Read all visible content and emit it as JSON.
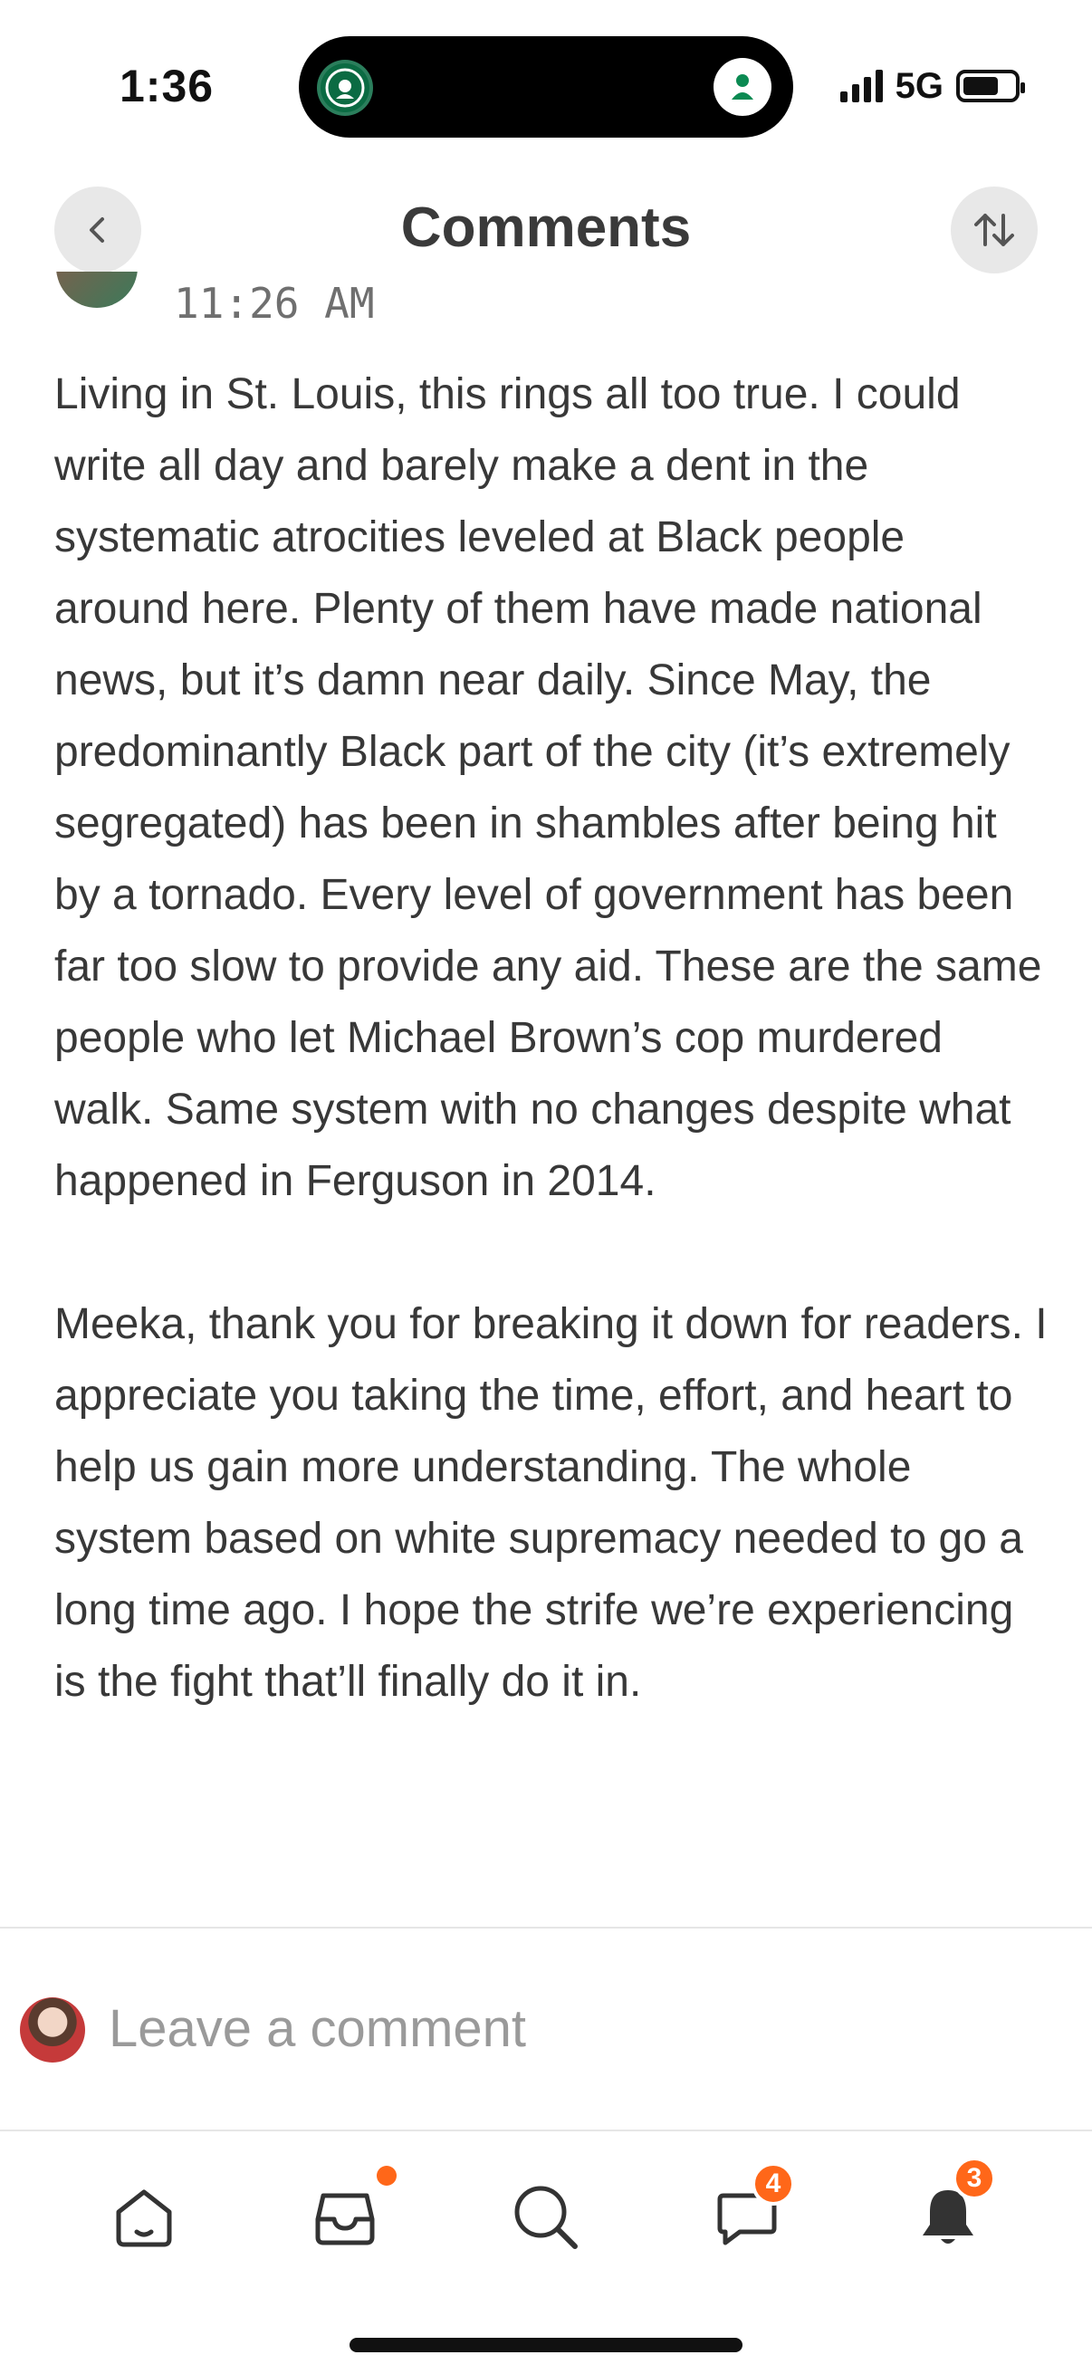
{
  "status_bar": {
    "time": "1:36",
    "network": "5G",
    "island_left_icon": "starbucks-logo-icon",
    "island_right_icon": "person-activity-icon"
  },
  "header": {
    "title": "Comments",
    "back_icon": "chevron-left-icon",
    "sort_icon": "sort-arrows-icon"
  },
  "comment": {
    "timestamp": "11:26 AM",
    "paragraphs": [
      "Living in St. Louis, this rings all too true. I could write all day and barely make a dent in the systematic atrocities leveled at Black people around here. Plenty of them have made national news, but it’s damn near daily. Since May, the predominantly Black part of the city (it’s extremely segregated) has been in shambles after being hit by a tornado. Every level of government has been far too slow to provide any aid. These are the same people who let Michael Brown’s cop murdered walk. Same system with no changes despite what happened in Ferguson in 2014.",
      "Meeka, thank you for breaking it down for readers. I appreciate you taking the time, effort, and heart to help us gain more understanding. The whole system based on white supremacy needed to go a long time ago. I hope the strife we’re experiencing is the fight that’ll finally do it in."
    ]
  },
  "compose": {
    "placeholder": "Leave a comment"
  },
  "tabbar": {
    "tabs": [
      {
        "icon": "home-icon"
      },
      {
        "icon": "inbox-icon"
      },
      {
        "icon": "search-icon"
      },
      {
        "icon": "chat-bubble-icon",
        "badge": "4"
      },
      {
        "icon": "bell-icon",
        "badge": "3"
      }
    ]
  },
  "colors": {
    "accent": "#ff6719",
    "text": "#383838",
    "muted": "#9a9a9a"
  }
}
